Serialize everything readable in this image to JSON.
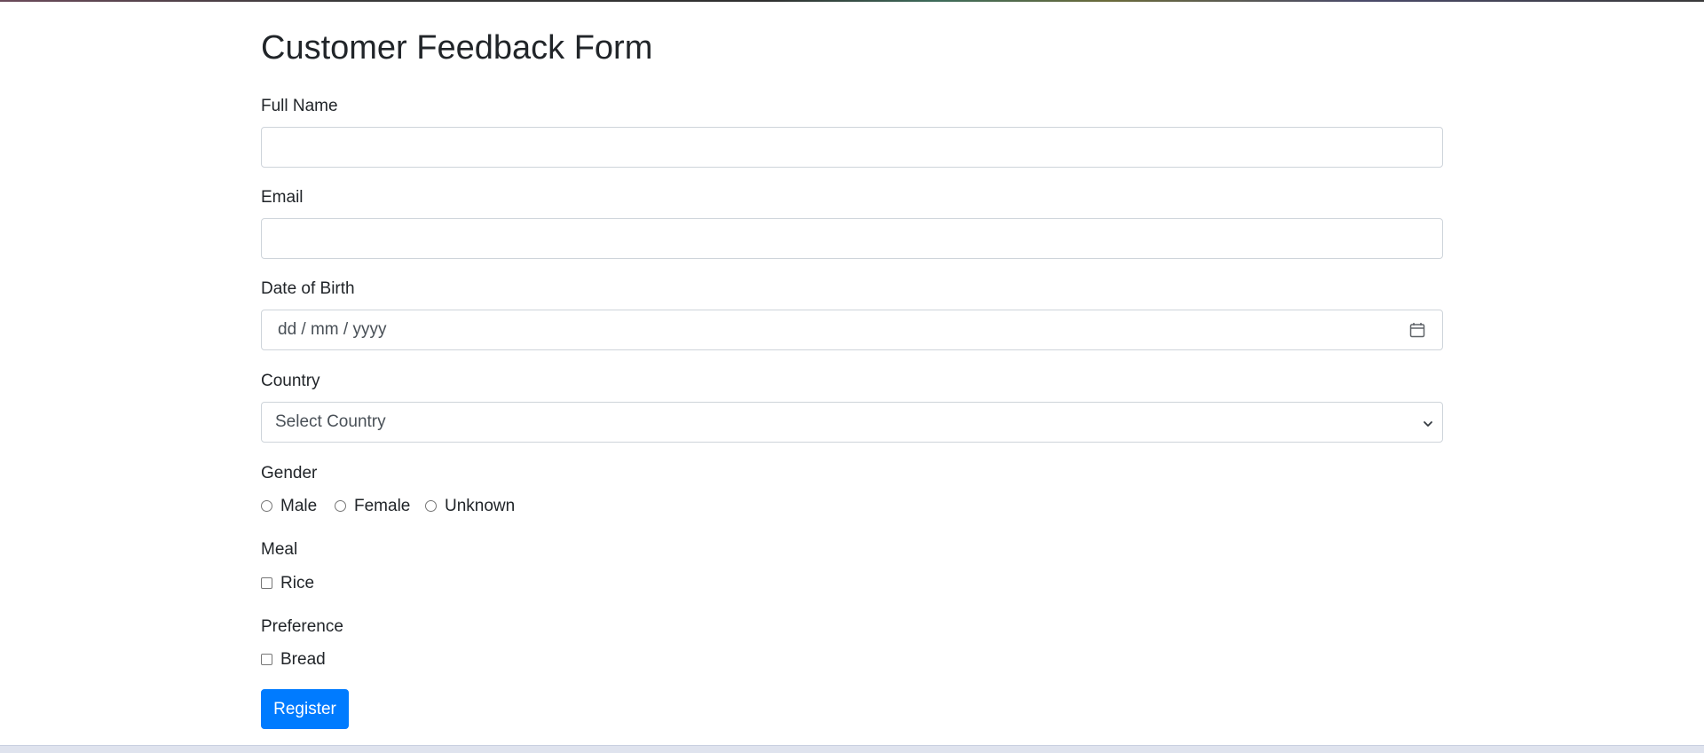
{
  "form": {
    "title": "Customer Feedback Form",
    "full_name": {
      "label": "Full Name",
      "value": "",
      "placeholder": ""
    },
    "email": {
      "label": "Email",
      "value": "",
      "placeholder": ""
    },
    "dob": {
      "label": "Date of Birth",
      "placeholder": "dd / mm / yyyy",
      "icon": "calendar-icon"
    },
    "country": {
      "label": "Country",
      "selected": "Select Country",
      "icon": "chevron-down-icon"
    },
    "gender": {
      "label": "Gender",
      "options": [
        {
          "label": "Male",
          "checked": false
        },
        {
          "label": "Female",
          "checked": false
        },
        {
          "label": "Unknown",
          "checked": false
        }
      ]
    },
    "meal": {
      "label": "Meal",
      "options": [
        {
          "label": "Rice",
          "checked": false
        }
      ]
    },
    "preference": {
      "label": "Preference",
      "options": [
        {
          "label": "Bread",
          "checked": false
        }
      ]
    },
    "submit_label": "Register"
  },
  "colors": {
    "primary": "#007bff",
    "text": "#212529",
    "border": "#ced4da",
    "muted_text": "#495057"
  }
}
